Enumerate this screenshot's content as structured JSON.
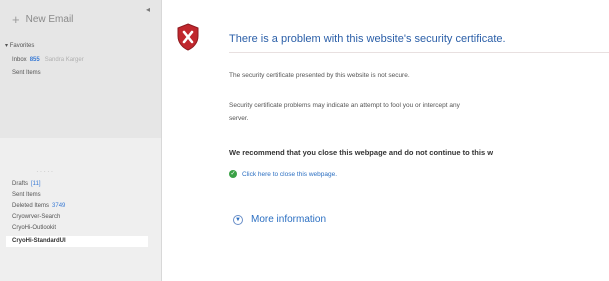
{
  "sidebar": {
    "new_email": {
      "icon": "plus-icon",
      "label": "New Email"
    },
    "pin_icon": "pin-icon",
    "favorites": {
      "label": "Favorites",
      "items": [
        {
          "label": "Inbox",
          "count": "855",
          "sub": "Sandra Karger"
        },
        {
          "label": "Sent Items"
        }
      ]
    },
    "folders": [
      {
        "label": "Drafts",
        "count": "[11]"
      },
      {
        "label": "Sent Items"
      },
      {
        "label": "Deleted Items",
        "count": "3749"
      },
      {
        "label": "Cryowrver-Search"
      },
      {
        "label": "CryoHi-Outlookit"
      },
      {
        "label": "CryoHi-StandardUI",
        "selected": true
      }
    ]
  },
  "error": {
    "icon": "shield-error-icon",
    "title": "There is a problem with this website's security certificate.",
    "message1": "The security certificate presented by this website is not secure.",
    "message2_line1": "Security certificate problems may indicate an attempt to fool you or intercept any",
    "message2_line2": "server.",
    "recommend": "We recommend that you close this webpage and do not continue to this w",
    "close_link": {
      "icon": "green-check-icon",
      "label": "Click here to close this webpage."
    },
    "more_info": {
      "icon": "chevron-down-circle-icon",
      "label": "More information"
    }
  },
  "colors": {
    "title_blue": "#2b5fa8",
    "link_blue": "#2b6fc2",
    "shield_red": "#c0272d",
    "check_green": "#3aa146"
  }
}
